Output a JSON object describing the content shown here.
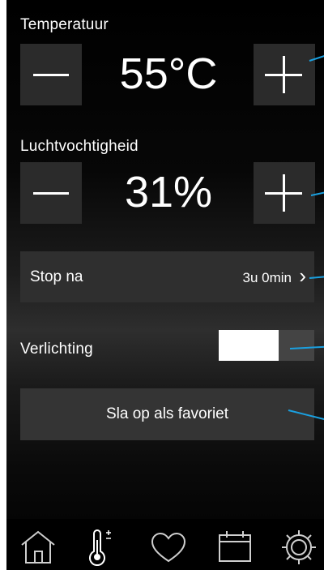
{
  "temperature": {
    "label": "Temperatuur",
    "value": "55°C",
    "decrease_icon": "minus-icon",
    "increase_icon": "plus-icon"
  },
  "humidity": {
    "label": "Luchtvochtigheid",
    "value": "31%",
    "decrease_icon": "minus-icon",
    "increase_icon": "plus-icon"
  },
  "stop_after": {
    "label": "Stop na",
    "value": "3u 0min",
    "chevron": "›"
  },
  "lighting": {
    "label": "Verlichting",
    "on": true
  },
  "favorite": {
    "label": "Sla op als favoriet"
  },
  "navbar": {
    "items": [
      {
        "icon": "home-icon",
        "active": false
      },
      {
        "icon": "thermometer-icon",
        "active": true
      },
      {
        "icon": "heart-icon",
        "active": false
      },
      {
        "icon": "calendar-icon",
        "active": false
      },
      {
        "icon": "gear-icon",
        "active": false
      }
    ]
  },
  "colors": {
    "accent_callout": "#1aa0e0",
    "button_bg": "#2b2b2b",
    "text": "#ffffff"
  }
}
